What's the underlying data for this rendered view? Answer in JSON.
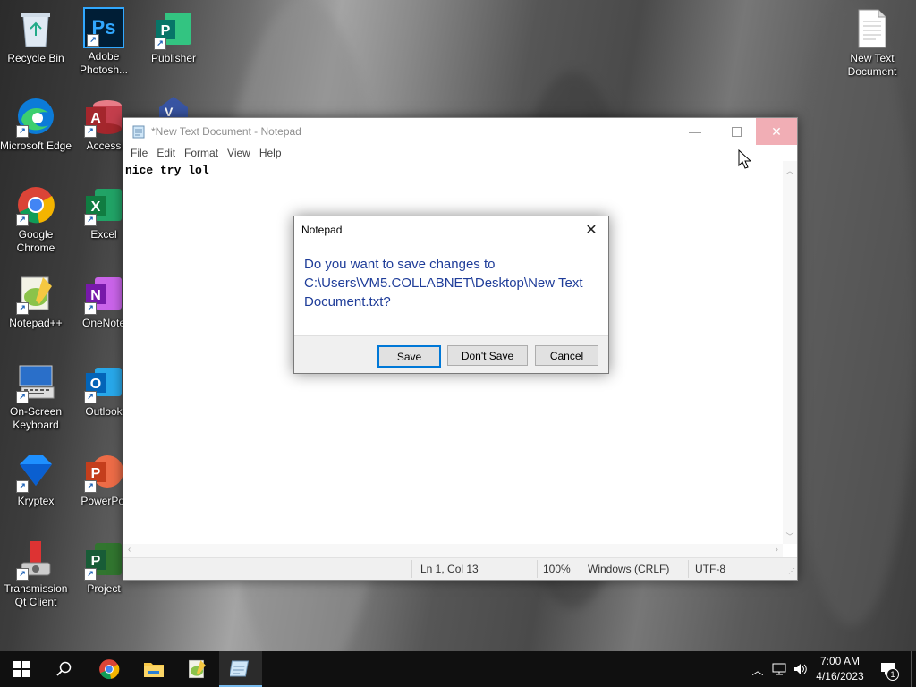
{
  "desktop": {
    "icons": [
      {
        "label": "Recycle Bin"
      },
      {
        "label": "Adobe Photosh..."
      },
      {
        "label": "Publisher"
      },
      {
        "label": "Microsoft Edge"
      },
      {
        "label": "Access"
      },
      {
        "label": "Google Chrome"
      },
      {
        "label": "Excel"
      },
      {
        "label": "Notepad++"
      },
      {
        "label": "OneNote"
      },
      {
        "label": "On-Screen Keyboard"
      },
      {
        "label": "Outlook"
      },
      {
        "label": "Kryptex"
      },
      {
        "label": "PowerPoi"
      },
      {
        "label": "Transmission Qt Client"
      },
      {
        "label": "Project"
      },
      {
        "label": "New Text Document"
      }
    ]
  },
  "notepad": {
    "title": "*New Text Document - Notepad",
    "menu": [
      "File",
      "Edit",
      "Format",
      "View",
      "Help"
    ],
    "content": "nice try lol",
    "status": {
      "position": "Ln 1, Col 13",
      "zoom": "100%",
      "line_ending": "Windows (CRLF)",
      "encoding": "UTF-8"
    }
  },
  "dialog": {
    "title": "Notepad",
    "message": "Do you want to save changes to C:\\Users\\VM5.COLLABNET\\Desktop\\New Text Document.txt?",
    "buttons": {
      "save": "Save",
      "dont_save": "Don't Save",
      "cancel": "Cancel"
    }
  },
  "taskbar": {
    "time": "7:00 AM",
    "date": "4/16/2023",
    "notification_count": "1",
    "accent": "#0078d7"
  }
}
